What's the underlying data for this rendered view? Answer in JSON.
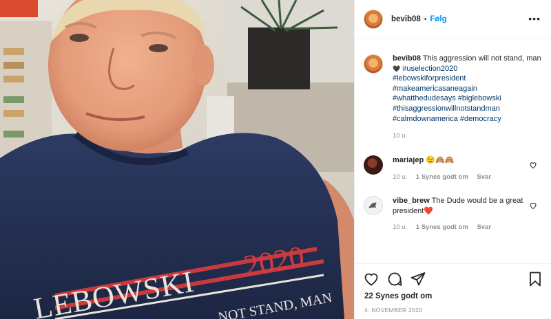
{
  "post": {
    "username": "bevib08",
    "separator": "•",
    "follow_label": "Følg",
    "more_label": "•••",
    "caption_text": "This aggression will not stand, man",
    "caption_emoji": "🖤",
    "hashtags_inline": "#uselection2020",
    "hashtags": [
      "#lebowskiforpresident",
      "#makeamericasaneagain",
      "#whatthedudesays",
      "#thisaggressionwillnotstandman"
    ],
    "hashtag_pair_1": "#whatthedudesays",
    "hashtag_pair_1b": "#biglebowski",
    "hashtag_pair_2": "#calmdownamerica",
    "hashtag_pair_2b": "#democracy",
    "caption_time": "10 u.",
    "likes": "22 Synes godt om",
    "date": "4. NOVEMBER 2020"
  },
  "comments": [
    {
      "username": "mariajep",
      "text": "😉🙈🙈",
      "time": "10 u.",
      "likes": "1 Synes godt om",
      "reply": "Svar"
    },
    {
      "username": "vibe_brew",
      "text": "The Dude would be a great president",
      "emoji": "❤️",
      "time": "10 u.",
      "likes": "1 Synes godt om",
      "reply": "Svar"
    }
  ],
  "shirt": {
    "brand": "LEBOWSKI",
    "year": "2020",
    "slogan": "NOT STAND, MAN"
  },
  "icons": {
    "like": "heart-icon",
    "comment": "comment-icon",
    "share": "share-icon",
    "save": "bookmark-icon"
  }
}
